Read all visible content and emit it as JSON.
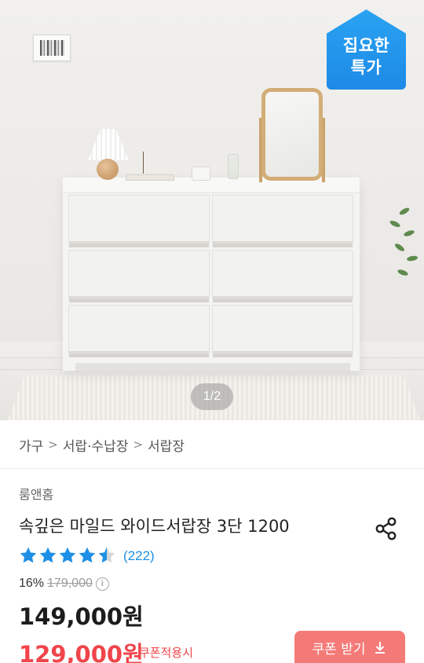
{
  "image": {
    "badge_line1": "집요한",
    "badge_line2": "특가",
    "counter": "1/2"
  },
  "breadcrumb": [
    {
      "label": "가구"
    },
    {
      "label": "서랍·수납장"
    },
    {
      "label": "서랍장"
    }
  ],
  "product": {
    "brand": "룸앤홈",
    "title": "속깊은 마일드 와이드서랍장 3단 1200",
    "rating": 4.5,
    "rating_count": "(222)",
    "discount_rate": "16%",
    "original_price": "179,000",
    "sale_price": "149,000원",
    "coupon_price": "129,000원",
    "coupon_note": "쿠폰적용시",
    "coupon_button": "쿠폰 받기"
  },
  "icons": {
    "share": "share-icon",
    "info": "info-icon",
    "download": "download-icon",
    "star": "star-icon"
  },
  "colors": {
    "badge": "#1d8ae6",
    "star": "#1d8fe6",
    "coupon_price": "#f0454b",
    "coupon_button": "#f47a78"
  }
}
